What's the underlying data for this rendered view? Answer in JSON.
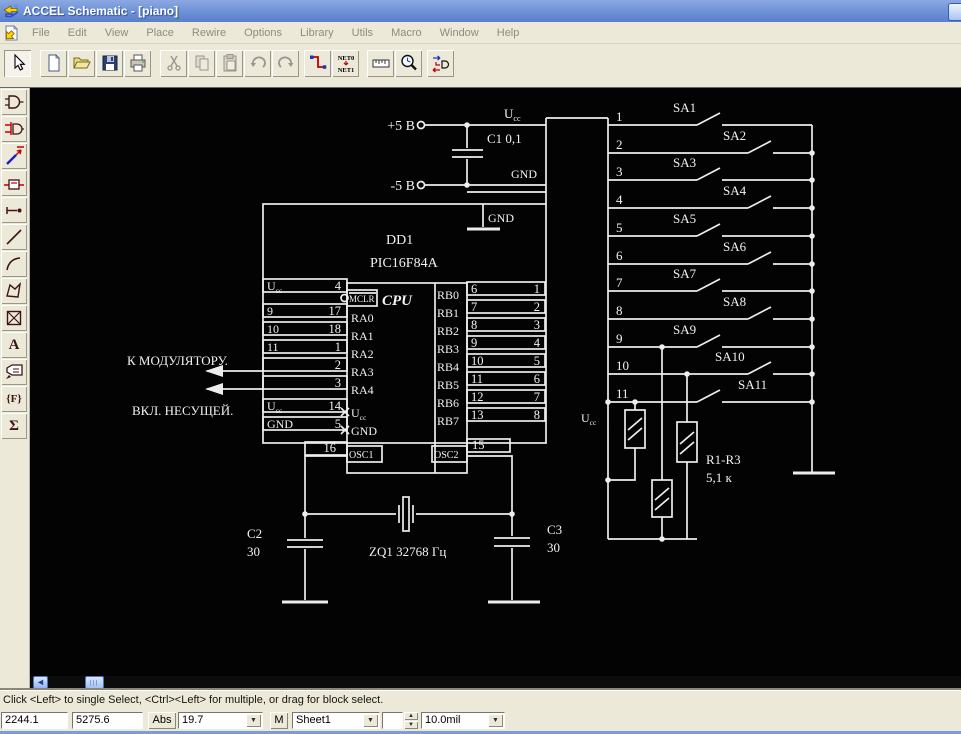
{
  "window": {
    "title": "ACCEL Schematic - [piano]"
  },
  "menu": {
    "items": [
      "File",
      "Edit",
      "View",
      "Place",
      "Rewire",
      "Options",
      "Library",
      "Utils",
      "Macro",
      "Window",
      "Help"
    ]
  },
  "toolbar": {
    "net0": "NET0",
    "net1": "NET1",
    "buttons": [
      {
        "name": "select-tool",
        "active": true
      },
      {
        "name": "new-document"
      },
      {
        "name": "open-file"
      },
      {
        "name": "save-file"
      },
      {
        "name": "print"
      },
      {
        "name": "cut",
        "disabled": true
      },
      {
        "name": "copy",
        "disabled": true
      },
      {
        "name": "paste",
        "disabled": true
      },
      {
        "name": "undo",
        "disabled": true
      },
      {
        "name": "redo",
        "disabled": true
      },
      {
        "name": "place-wire-tool"
      },
      {
        "name": "rename-net-tool"
      },
      {
        "name": "measure-tool"
      },
      {
        "name": "zoom-tool"
      },
      {
        "name": "connectivity-tool"
      }
    ]
  },
  "palette": {
    "items": [
      {
        "name": "place-part"
      },
      {
        "name": "place-wire"
      },
      {
        "name": "place-bus"
      },
      {
        "name": "place-port"
      },
      {
        "name": "place-pin"
      },
      {
        "name": "place-line"
      },
      {
        "name": "place-arc"
      },
      {
        "name": "place-polygon"
      },
      {
        "name": "place-ref-point"
      },
      {
        "name": "place-text",
        "glyph": "A"
      },
      {
        "name": "place-attribute"
      },
      {
        "name": "place-field",
        "glyph": "{F}"
      },
      {
        "name": "place-ieee-symbol",
        "glyph": "Σ"
      }
    ]
  },
  "schematic": {
    "power": {
      "plus": "+5 В",
      "minus": "-5 В",
      "ucc": {
        "main": "U",
        "sub": "cc"
      },
      "gnd": "GND",
      "gnd2": "GND",
      "c1": "C1 0,1"
    },
    "chip": {
      "ref": "DD1",
      "part": "PIC16F84A",
      "cpu": "CPU",
      "mclr": "MCLR",
      "osc1": "OSC1",
      "osc2": "OSC2",
      "pin16": "16",
      "pin15": "15",
      "left_rows": [
        {
          "ext": {
            "main": "U",
            "sub": "cc"
          },
          "pin": "4"
        },
        {
          "ext": "9",
          "pin": "17"
        },
        {
          "ext": "10",
          "pin": "18"
        },
        {
          "ext": "11",
          "pin": "1"
        },
        {
          "ext": "",
          "pin": "2"
        },
        {
          "ext": "",
          "pin": "3"
        },
        {
          "ext": {
            "main": "U",
            "sub": "cc"
          },
          "pin": "14"
        },
        {
          "ext": "GND",
          "pin": "5"
        }
      ],
      "ra": [
        "RA0",
        "RA1",
        "RA2",
        "RA3",
        "RA4",
        {
          "main": "U",
          "sub": "cc"
        },
        "GND"
      ],
      "rb": [
        "RB0",
        "RB1",
        "RB2",
        "RB3",
        "RB4",
        "RB5",
        "RB6",
        "RB7"
      ],
      "right_rows": [
        {
          "pin": "6",
          "net": "1"
        },
        {
          "pin": "7",
          "net": "2"
        },
        {
          "pin": "8",
          "net": "3"
        },
        {
          "pin": "9",
          "net": "4"
        },
        {
          "pin": "10",
          "net": "5"
        },
        {
          "pin": "11",
          "net": "6"
        },
        {
          "pin": "12",
          "net": "7"
        },
        {
          "pin": "13",
          "net": "8"
        }
      ]
    },
    "arrows": [
      {
        "label": "К МОДУЛЯТОРУ."
      },
      {
        "label": "ВКЛ. НЕСУЩЕЙ."
      }
    ],
    "keys": {
      "rows": [
        {
          "num": "1",
          "label": "SA1"
        },
        {
          "num": "2",
          "label": "SA2"
        },
        {
          "num": "3",
          "label": "SA3"
        },
        {
          "num": "4",
          "label": "SA4"
        },
        {
          "num": "5",
          "label": "SA5"
        },
        {
          "num": "6",
          "label": "SA6"
        },
        {
          "num": "7",
          "label": "SA7"
        },
        {
          "num": "8",
          "label": "SA8"
        },
        {
          "num": "9",
          "label": "SA9"
        },
        {
          "num": "10",
          "label": "SA10"
        },
        {
          "num": "11",
          "label": "SA11"
        }
      ]
    },
    "resistors": {
      "ucc": {
        "main": "U",
        "sub": "cc"
      },
      "label1": "R1-R3",
      "label2": "5,1 к"
    },
    "osc": {
      "c2": "C2",
      "c2v": "30",
      "c3": "C3",
      "c3v": "30",
      "zq": "ZQ1 32768 Гц"
    }
  },
  "statusbar": {
    "hint": "Click <Left> to single Select, <Ctrl><Left> for multiple, or drag for block select.",
    "x": "2244.1",
    "y": "5275.6",
    "abs": "Abs",
    "zoom": "19.7",
    "m": "M",
    "sheet": "Sheet1",
    "grid": "10.0mil"
  },
  "colors": {
    "titlebar_blue": "#7295d8",
    "chrome_beige": "#ece9d8",
    "schematic_line": "#ededed"
  }
}
